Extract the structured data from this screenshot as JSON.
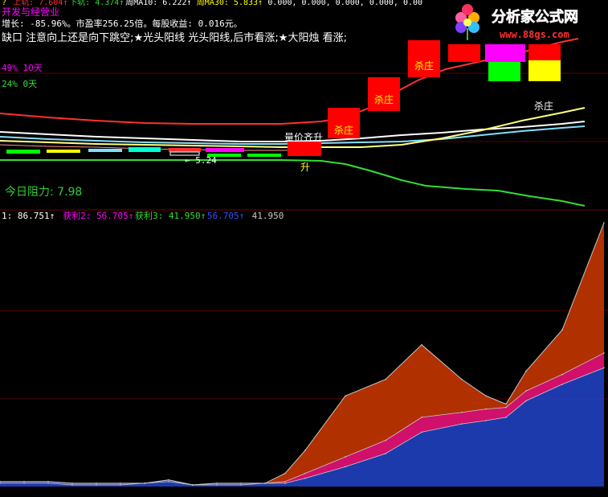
{
  "colors": {
    "background": "#000000",
    "divider": "#7a0000",
    "grid": "#5a0000",
    "candle_up": "#ff0000",
    "candle_down": "#00ff00",
    "candle_neutral": "#ffff00",
    "magenta": "#ff00ff",
    "upper_band": "#ff3030",
    "ma_white": "#ffffff",
    "ma_yellow": "#ffff80",
    "ma_cyan": "#80e0ff",
    "ma_pink": "#ff9090",
    "green_line": "#33dd33",
    "resistance_text": "#33cc33",
    "fill_brown": "#b03000",
    "fill_magenta": "#d0106a",
    "fill_blue": "#2040c0",
    "sub_outline": "#c8c8c8"
  },
  "header": {
    "line1": [
      {
        "text": "?",
        "color": "#ffff00"
      },
      {
        "text": "上轨: 7.604↑",
        "color": "#ff3030"
      },
      {
        "text": "下轨: 4.374↑",
        "color": "#33dd33"
      },
      {
        "text": "周MA10: 6.222↑",
        "color": "#ffffff"
      },
      {
        "text": "周MA30: 5.833↑",
        "color": "#ffff00"
      },
      {
        "text": "0.000, 0.000, 0.000, 0.000, 0.00",
        "color": "#ffffff"
      }
    ],
    "line2": "开发与经营业",
    "line3": "增长: -85.96%。市盈率256.25倍。每股收益: 0.016元。",
    "line4": "缺口 注意向上还是向下跳空;★光头阳线 光头阳线,后市看涨;★大阳烛 看涨;",
    "stat1": "49% 10天",
    "stat2": "24% 0天"
  },
  "logo": {
    "title": "分析家公式网",
    "url": "www.88gs.com"
  },
  "annotations": {
    "kill_labels": [
      "杀庄",
      "杀庄",
      "杀庄",
      "杀庄"
    ],
    "kill_label_top": "杀庄",
    "price_rise": "量价齐升",
    "rise": "升",
    "low_marker": "← 5.24",
    "resistance": "今日阻力: 7.98"
  },
  "sub_legend": [
    {
      "text": "1: 86.751↑",
      "color": "#ffffff"
    },
    {
      "text": "获利2: 56.705↑",
      "color": "#ff00ff"
    },
    {
      "text": "获利3: 41.950↑",
      "color": "#33dd33"
    },
    {
      "text": "56.705↑",
      "color": "#3050ff"
    },
    {
      "text": "41.950",
      "color": "#c8c8c8"
    }
  ],
  "chart_data": {
    "type": "area",
    "panels": [
      {
        "panel": "price",
        "series": [
          {
            "name": "上轨",
            "values": [
              7.05,
              7.0,
              6.95,
              6.9,
              6.88,
              6.88,
              6.9,
              6.95,
              7.1,
              7.35,
              7.6,
              7.9,
              8.1
            ]
          },
          {
            "name": "周MA10",
            "values": [
              6.2,
              6.15,
              6.1,
              6.05,
              6.0,
              5.98,
              6.0,
              6.05,
              6.12,
              6.25,
              6.42,
              6.6,
              6.8
            ]
          },
          {
            "name": "周MA30",
            "values": [
              6.0,
              5.95,
              5.9,
              5.85,
              5.8,
              5.78,
              5.78,
              5.8,
              5.9,
              6.1,
              6.3,
              6.55,
              6.85
            ]
          },
          {
            "name": "下轨",
            "values": [
              5.4,
              5.38,
              5.36,
              5.35,
              5.34,
              5.33,
              5.32,
              5.2,
              4.95,
              4.75,
              4.6,
              4.5,
              4.37
            ]
          }
        ]
      },
      {
        "panel": "profit",
        "x": [
          0,
          30,
          60,
          90,
          120,
          150,
          180,
          210,
          240,
          270,
          300,
          330,
          355,
          380,
          430,
          480,
          525,
          575,
          605,
          630,
          655,
          700,
          752
        ],
        "series": [
          {
            "name": "1",
            "values": [
              3,
              3,
              3,
              2,
              2,
              2,
              2,
              4,
              1,
              2,
              2,
              2,
              8,
              22,
              55,
              65,
              86,
              65,
              55,
              50,
              70,
              95,
              160
            ]
          },
          {
            "name": "获利2",
            "values": [
              2,
              2,
              2,
              1,
              1,
              1,
              2,
              3,
              1,
              1,
              1,
              2,
              3,
              8,
              18,
              28,
              42,
              45,
              47,
              48,
              58,
              68,
              81
            ]
          },
          {
            "name": "获利3",
            "values": [
              3,
              3,
              3,
              2,
              2,
              2,
              2,
              4,
              1,
              2,
              2,
              2,
              2,
              5,
              12,
              20,
              33,
              38,
              40,
              42,
              52,
              62,
              72
            ]
          }
        ]
      }
    ]
  }
}
